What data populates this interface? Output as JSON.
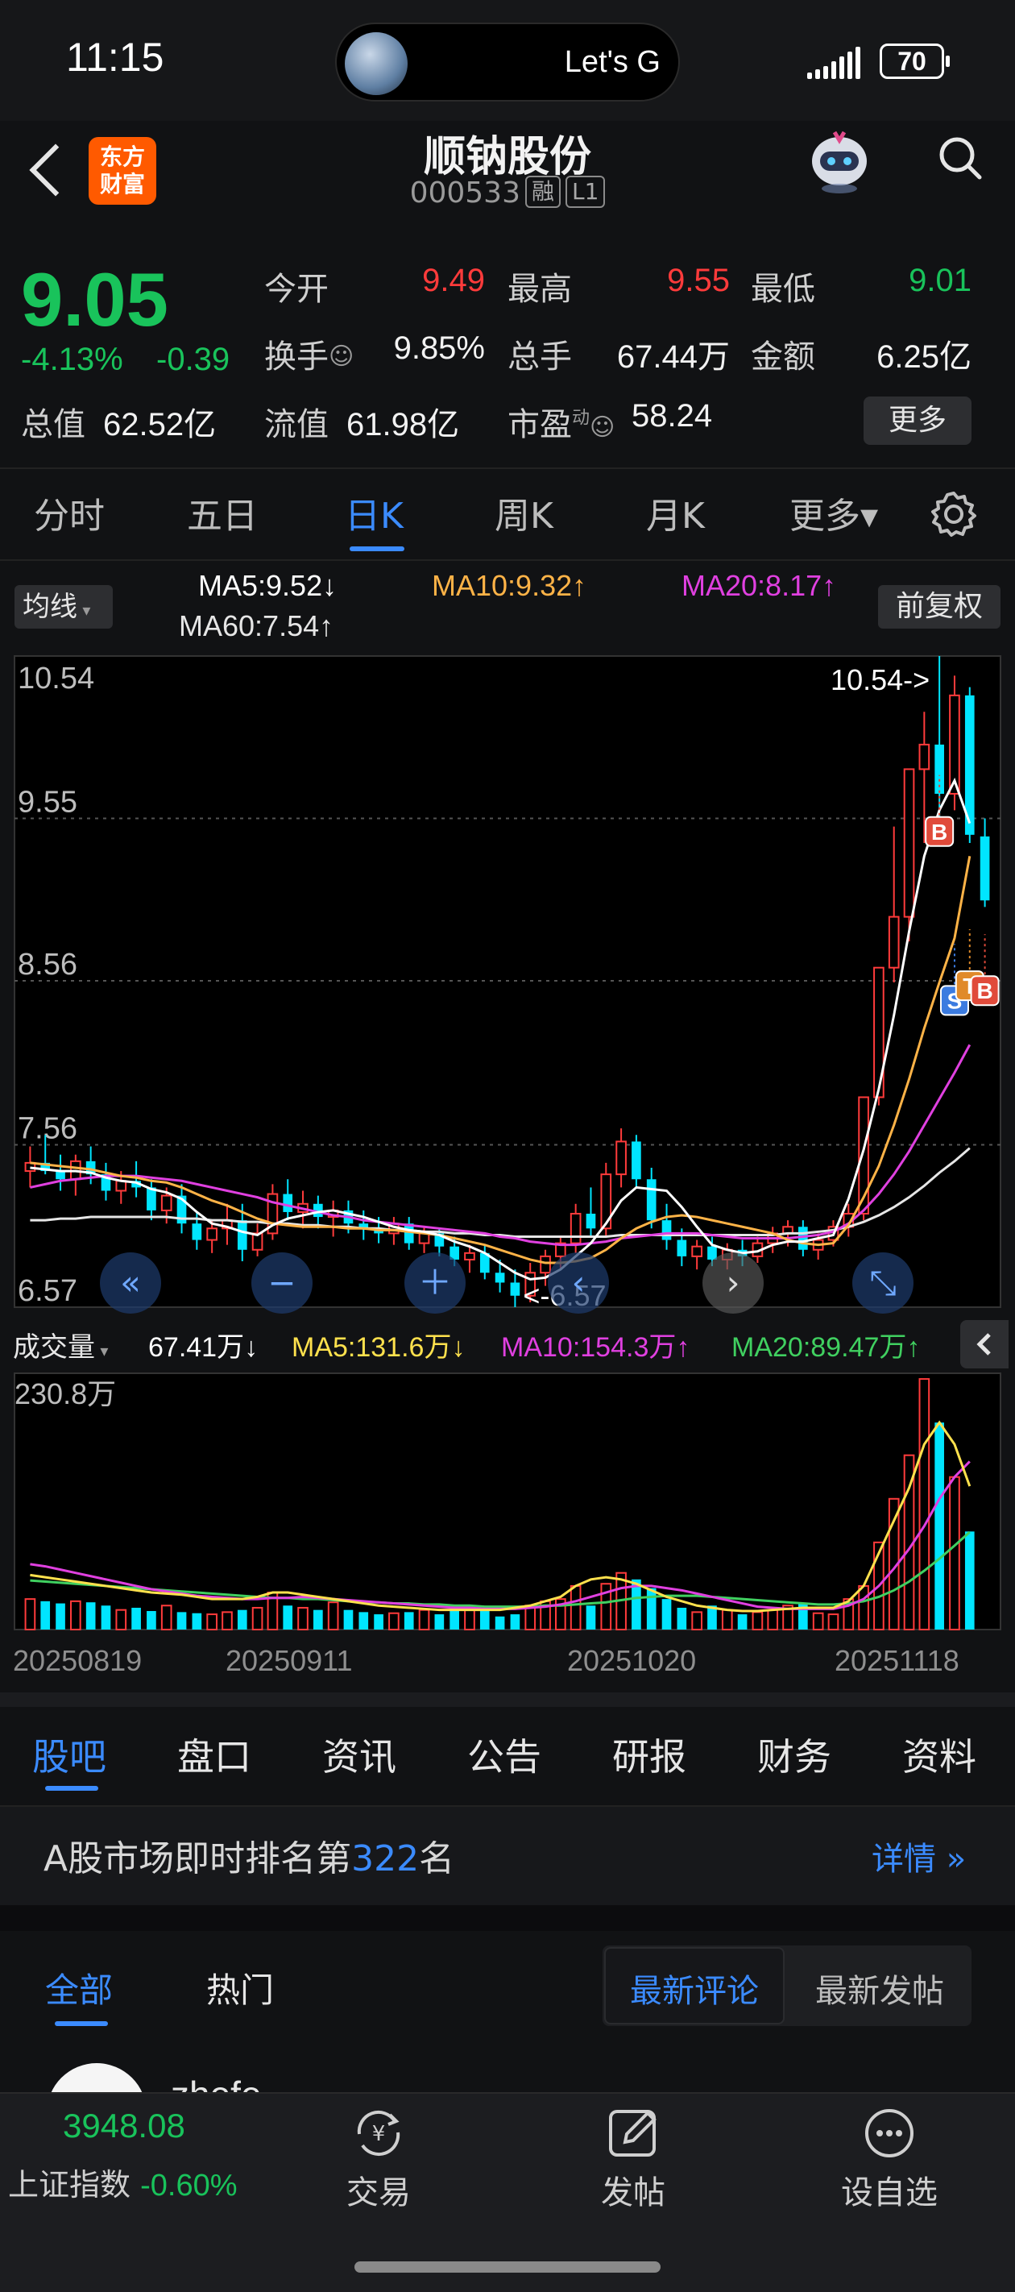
{
  "status_bar": {
    "time": "11:15",
    "island_text": "Let's G",
    "battery": "70"
  },
  "header": {
    "logo_text": "东方财富",
    "title": "顺钠股份",
    "code": "000533",
    "tag_rong": "融",
    "tag_level": "L1"
  },
  "quote": {
    "price": "9.05",
    "change_pct": "-4.13%",
    "change": "-0.39",
    "open_label": "今开",
    "open": "9.49",
    "high_label": "最高",
    "high": "9.55",
    "low_label": "最低",
    "low": "9.01",
    "turnover_label": "换手",
    "turnover": "9.85%",
    "volume_label": "总手",
    "volume": "67.44万",
    "amount_label": "金额",
    "amount": "6.25亿",
    "mktcap_label": "总值",
    "mktcap": "62.52亿",
    "float_label": "流值",
    "float": "61.98亿",
    "pe_label": "市盈",
    "pe_sup": "动",
    "pe": "58.24",
    "more_label": "更多"
  },
  "period_tabs": [
    "分时",
    "五日",
    "日K",
    "周K",
    "月K",
    "更多▾"
  ],
  "active_period": "日K",
  "ma_header": {
    "button": "均线",
    "ma5": "MA5:9.52↓",
    "ma10": "MA10:9.32↑",
    "ma20": "MA20:8.17↑",
    "ma60": "MA60:7.54↑",
    "adjust_button": "前复权",
    "colors": {
      "ma5": "#ffffff",
      "ma10": "#ffb347",
      "ma20": "#e040e0",
      "ma60": "#e6e6e6"
    }
  },
  "chart_data": [
    {
      "type": "candlestick",
      "title": "",
      "ylim": [
        6.57,
        10.54
      ],
      "y_ticks": [
        "10.54",
        "9.55",
        "8.56",
        "7.56",
        "6.57"
      ],
      "annotations": {
        "max": "10.54->",
        "min": "<-6.57"
      },
      "trade_markers": [
        "B",
        "S",
        "T",
        "B"
      ],
      "candles": [
        {
          "o": 7.4,
          "h": 7.55,
          "l": 7.3,
          "c": 7.45
        },
        {
          "o": 7.45,
          "h": 7.62,
          "l": 7.38,
          "c": 7.4
        },
        {
          "o": 7.4,
          "h": 7.5,
          "l": 7.28,
          "c": 7.35
        },
        {
          "o": 7.35,
          "h": 7.5,
          "l": 7.25,
          "c": 7.46
        },
        {
          "o": 7.46,
          "h": 7.55,
          "l": 7.32,
          "c": 7.38
        },
        {
          "o": 7.38,
          "h": 7.45,
          "l": 7.22,
          "c": 7.28
        },
        {
          "o": 7.28,
          "h": 7.4,
          "l": 7.2,
          "c": 7.34
        },
        {
          "o": 7.34,
          "h": 7.46,
          "l": 7.24,
          "c": 7.3
        },
        {
          "o": 7.3,
          "h": 7.35,
          "l": 7.1,
          "c": 7.16
        },
        {
          "o": 7.16,
          "h": 7.3,
          "l": 7.08,
          "c": 7.25
        },
        {
          "o": 7.25,
          "h": 7.32,
          "l": 7.02,
          "c": 7.08
        },
        {
          "o": 7.08,
          "h": 7.15,
          "l": 6.92,
          "c": 6.98
        },
        {
          "o": 6.98,
          "h": 7.1,
          "l": 6.9,
          "c": 7.05
        },
        {
          "o": 7.05,
          "h": 7.2,
          "l": 6.95,
          "c": 7.1
        },
        {
          "o": 7.1,
          "h": 7.2,
          "l": 6.85,
          "c": 6.92
        },
        {
          "o": 6.92,
          "h": 7.08,
          "l": 6.88,
          "c": 7.02
        },
        {
          "o": 7.02,
          "h": 7.32,
          "l": 6.98,
          "c": 7.26
        },
        {
          "o": 7.26,
          "h": 7.35,
          "l": 7.1,
          "c": 7.15
        },
        {
          "o": 7.15,
          "h": 7.28,
          "l": 7.05,
          "c": 7.2
        },
        {
          "o": 7.2,
          "h": 7.25,
          "l": 7.05,
          "c": 7.12
        },
        {
          "o": 7.12,
          "h": 7.22,
          "l": 7.0,
          "c": 7.16
        },
        {
          "o": 7.16,
          "h": 7.22,
          "l": 7.02,
          "c": 7.08
        },
        {
          "o": 7.08,
          "h": 7.16,
          "l": 6.98,
          "c": 7.05
        },
        {
          "o": 7.05,
          "h": 7.12,
          "l": 6.96,
          "c": 7.02
        },
        {
          "o": 7.02,
          "h": 7.12,
          "l": 6.95,
          "c": 7.08
        },
        {
          "o": 7.08,
          "h": 7.12,
          "l": 6.92,
          "c": 6.96
        },
        {
          "o": 6.96,
          "h": 7.06,
          "l": 6.9,
          "c": 7.02
        },
        {
          "o": 7.02,
          "h": 7.05,
          "l": 6.88,
          "c": 6.94
        },
        {
          "o": 6.94,
          "h": 7.0,
          "l": 6.82,
          "c": 6.86
        },
        {
          "o": 6.86,
          "h": 6.95,
          "l": 6.78,
          "c": 6.9
        },
        {
          "o": 6.9,
          "h": 6.95,
          "l": 6.74,
          "c": 6.78
        },
        {
          "o": 6.78,
          "h": 6.86,
          "l": 6.66,
          "c": 6.72
        },
        {
          "o": 6.72,
          "h": 6.8,
          "l": 6.57,
          "c": 6.64
        },
        {
          "o": 6.64,
          "h": 6.84,
          "l": 6.6,
          "c": 6.78
        },
        {
          "o": 6.78,
          "h": 6.92,
          "l": 6.7,
          "c": 6.88
        },
        {
          "o": 6.88,
          "h": 7.0,
          "l": 6.8,
          "c": 6.96
        },
        {
          "o": 6.96,
          "h": 7.2,
          "l": 6.9,
          "c": 7.14
        },
        {
          "o": 7.14,
          "h": 7.3,
          "l": 7.0,
          "c": 7.05
        },
        {
          "o": 7.05,
          "h": 7.45,
          "l": 7.0,
          "c": 7.38
        },
        {
          "o": 7.38,
          "h": 7.66,
          "l": 7.3,
          "c": 7.58
        },
        {
          "o": 7.58,
          "h": 7.62,
          "l": 7.3,
          "c": 7.35
        },
        {
          "o": 7.35,
          "h": 7.42,
          "l": 7.05,
          "c": 7.1
        },
        {
          "o": 7.1,
          "h": 7.2,
          "l": 6.92,
          "c": 6.98
        },
        {
          "o": 6.98,
          "h": 7.05,
          "l": 6.82,
          "c": 6.88
        },
        {
          "o": 6.88,
          "h": 6.98,
          "l": 6.8,
          "c": 6.94
        },
        {
          "o": 6.94,
          "h": 7.0,
          "l": 6.82,
          "c": 6.86
        },
        {
          "o": 6.86,
          "h": 6.96,
          "l": 6.8,
          "c": 6.92
        },
        {
          "o": 6.92,
          "h": 6.98,
          "l": 6.82,
          "c": 6.88
        },
        {
          "o": 6.88,
          "h": 7.0,
          "l": 6.84,
          "c": 6.96
        },
        {
          "o": 6.96,
          "h": 7.06,
          "l": 6.9,
          "c": 7.02
        },
        {
          "o": 7.02,
          "h": 7.1,
          "l": 6.94,
          "c": 7.06
        },
        {
          "o": 7.06,
          "h": 7.1,
          "l": 6.88,
          "c": 6.92
        },
        {
          "o": 6.92,
          "h": 7.02,
          "l": 6.86,
          "c": 6.98
        },
        {
          "o": 6.98,
          "h": 7.1,
          "l": 6.94,
          "c": 7.06
        },
        {
          "o": 7.06,
          "h": 7.2,
          "l": 7.0,
          "c": 7.14
        },
        {
          "o": 7.14,
          "h": 7.85,
          "l": 7.1,
          "c": 7.85
        },
        {
          "o": 7.85,
          "h": 8.64,
          "l": 7.8,
          "c": 8.64
        },
        {
          "o": 8.64,
          "h": 9.5,
          "l": 8.55,
          "c": 8.95
        },
        {
          "o": 8.95,
          "h": 9.85,
          "l": 8.8,
          "c": 9.85
        },
        {
          "o": 9.85,
          "h": 10.2,
          "l": 9.4,
          "c": 10.0
        },
        {
          "o": 10.0,
          "h": 10.54,
          "l": 9.55,
          "c": 9.7
        },
        {
          "o": 9.7,
          "h": 10.42,
          "l": 9.6,
          "c": 10.3
        },
        {
          "o": 10.3,
          "h": 10.35,
          "l": 9.4,
          "c": 9.45
        },
        {
          "o": 9.44,
          "h": 9.55,
          "l": 9.01,
          "c": 9.05
        }
      ],
      "ma5": [
        7.42,
        7.41,
        7.4,
        7.4,
        7.39,
        7.36,
        7.34,
        7.33,
        7.29,
        7.27,
        7.23,
        7.15,
        7.08,
        7.06,
        7.03,
        7.01,
        7.07,
        7.11,
        7.13,
        7.15,
        7.16,
        7.14,
        7.12,
        7.09,
        7.06,
        7.04,
        7.03,
        7.01,
        6.97,
        6.94,
        6.9,
        6.84,
        6.78,
        6.74,
        6.75,
        6.8,
        6.88,
        6.96,
        7.08,
        7.22,
        7.3,
        7.29,
        7.28,
        7.18,
        7.06,
        6.95,
        6.92,
        6.9,
        6.91,
        6.95,
        6.97,
        6.97,
        6.99,
        7.01,
        7.23,
        7.53,
        7.9,
        8.35,
        8.86,
        9.32,
        9.6,
        9.78,
        9.52
      ],
      "ma10": [
        7.45,
        7.44,
        7.43,
        7.42,
        7.41,
        7.39,
        7.37,
        7.36,
        7.34,
        7.33,
        7.3,
        7.26,
        7.22,
        7.19,
        7.15,
        7.11,
        7.08,
        7.07,
        7.06,
        7.06,
        7.06,
        7.05,
        7.05,
        7.04,
        7.04,
        7.03,
        7.02,
        7.01,
        6.99,
        6.97,
        6.95,
        6.92,
        6.89,
        6.86,
        6.84,
        6.84,
        6.85,
        6.87,
        6.92,
        6.99,
        7.05,
        7.09,
        7.12,
        7.13,
        7.12,
        7.1,
        7.08,
        7.06,
        7.04,
        7.02,
        6.98,
        6.96,
        6.95,
        6.96,
        7.07,
        7.24,
        7.43,
        7.68,
        7.96,
        8.27,
        8.55,
        8.82,
        9.32
      ],
      "ma20": [
        7.3,
        7.32,
        7.34,
        7.35,
        7.36,
        7.37,
        7.37,
        7.37,
        7.36,
        7.35,
        7.34,
        7.32,
        7.3,
        7.28,
        7.26,
        7.24,
        7.21,
        7.19,
        7.17,
        7.15,
        7.13,
        7.12,
        7.1,
        7.09,
        7.08,
        7.07,
        7.06,
        7.05,
        7.04,
        7.03,
        7.02,
        7.0,
        6.99,
        6.97,
        6.96,
        6.95,
        6.95,
        6.96,
        6.97,
        6.99,
        7.0,
        7.01,
        7.02,
        7.02,
        7.02,
        7.01,
        7.0,
        6.99,
        6.99,
        6.99,
        6.99,
        7.0,
        7.01,
        7.03,
        7.08,
        7.16,
        7.26,
        7.38,
        7.52,
        7.68,
        7.84,
        8.0,
        8.17
      ],
      "ma60": [
        7.1,
        7.1,
        7.11,
        7.11,
        7.12,
        7.12,
        7.12,
        7.12,
        7.12,
        7.12,
        7.11,
        7.11,
        7.1,
        7.1,
        7.09,
        7.09,
        7.08,
        7.08,
        7.07,
        7.07,
        7.06,
        7.06,
        7.05,
        7.05,
        7.04,
        7.04,
        7.03,
        7.03,
        7.02,
        7.02,
        7.01,
        7.01,
        7.0,
        7.0,
        7.0,
        7.0,
        7.0,
        7.0,
        7.0,
        7.01,
        7.01,
        7.01,
        7.01,
        7.01,
        7.01,
        7.01,
        7.01,
        7.01,
        7.01,
        7.01,
        7.02,
        7.02,
        7.03,
        7.04,
        7.06,
        7.09,
        7.13,
        7.18,
        7.24,
        7.31,
        7.39,
        7.46,
        7.54
      ]
    },
    {
      "type": "bar",
      "title": "",
      "ylim": [
        0,
        230.8
      ],
      "y_ticks": [
        "230.8万"
      ],
      "x_ticks": [
        "20250819",
        "20250911",
        "20251020",
        "20251118"
      ],
      "volume_wan": [
        28,
        26,
        24,
        26,
        25,
        22,
        18,
        20,
        17,
        22,
        16,
        15,
        14,
        16,
        18,
        20,
        34,
        22,
        20,
        18,
        25,
        18,
        16,
        14,
        15,
        16,
        18,
        14,
        20,
        19,
        17,
        12,
        14,
        22,
        26,
        28,
        40,
        22,
        42,
        52,
        46,
        38,
        28,
        20,
        16,
        22,
        18,
        14,
        16,
        18,
        22,
        24,
        15,
        14,
        28,
        40,
        80,
        120,
        160,
        230,
        190,
        140,
        90
      ],
      "ma5_wan": [
        50,
        48,
        46,
        44,
        42,
        40,
        38,
        36,
        34,
        33,
        32,
        30,
        28,
        28,
        28,
        30,
        34,
        34,
        32,
        30,
        28,
        26,
        24,
        22,
        21,
        20,
        19,
        18,
        18,
        18,
        18,
        18,
        20,
        22,
        26,
        30,
        40,
        46,
        48,
        46,
        42,
        36,
        30,
        26,
        22,
        20,
        18,
        17,
        17,
        18,
        19,
        20,
        20,
        20,
        26,
        40,
        70,
        100,
        130,
        170,
        190,
        170,
        131.6
      ],
      "ma10_wan": [
        60,
        58,
        55,
        52,
        49,
        46,
        43,
        40,
        37,
        35,
        33,
        31,
        30,
        29,
        28,
        28,
        29,
        29,
        30,
        29,
        28,
        27,
        26,
        25,
        24,
        23,
        22,
        21,
        20,
        20,
        19,
        19,
        19,
        20,
        21,
        23,
        26,
        30,
        34,
        38,
        40,
        40,
        38,
        36,
        33,
        30,
        27,
        24,
        21,
        20,
        19,
        19,
        19,
        19,
        22,
        28,
        40,
        56,
        74,
        95,
        120,
        140,
        154.3
      ],
      "ma20_wan": [
        45,
        44,
        43,
        42,
        41,
        40,
        39,
        38,
        37,
        36,
        35,
        34,
        33,
        32,
        31,
        30,
        29,
        29,
        28,
        28,
        27,
        26,
        25,
        25,
        24,
        24,
        23,
        23,
        22,
        22,
        21,
        21,
        21,
        21,
        22,
        22,
        23,
        24,
        25,
        27,
        29,
        30,
        31,
        31,
        31,
        30,
        29,
        28,
        27,
        26,
        25,
        24,
        23,
        23,
        24,
        26,
        30,
        36,
        44,
        54,
        65,
        77,
        89.47
      ]
    }
  ],
  "volume_header": {
    "button": "成交量",
    "current": "67.41万↓",
    "ma5": "MA5:131.6万↓",
    "ma10": "MA10:154.3万↑",
    "ma20": "MA20:89.47万↑",
    "colors": {
      "current": "#ffffff",
      "ma5": "#ffe14d",
      "ma10": "#e040e0",
      "ma20": "#40d060"
    }
  },
  "section_tabs": [
    "股吧",
    "盘口",
    "资讯",
    "公告",
    "研报",
    "财务",
    "资料"
  ],
  "active_section": "股吧",
  "rank": {
    "prefix": "A股市场即时排名第",
    "number": "322",
    "suffix": "名",
    "link": "详情"
  },
  "feed": {
    "tabs": [
      "全部",
      "热门"
    ],
    "sort_options": [
      "最新评论",
      "最新发帖"
    ],
    "peek_name": "zhefe"
  },
  "bottom_bar": {
    "index_value": "3948.08",
    "index_name": "上证指数",
    "index_change": "-0.60%",
    "items": [
      "交易",
      "发帖",
      "设自选"
    ]
  },
  "colors": {
    "up": "#ff3b3b",
    "down": "#19c35b",
    "candle_down": "#00e5ff",
    "accent": "#3b8bff"
  }
}
